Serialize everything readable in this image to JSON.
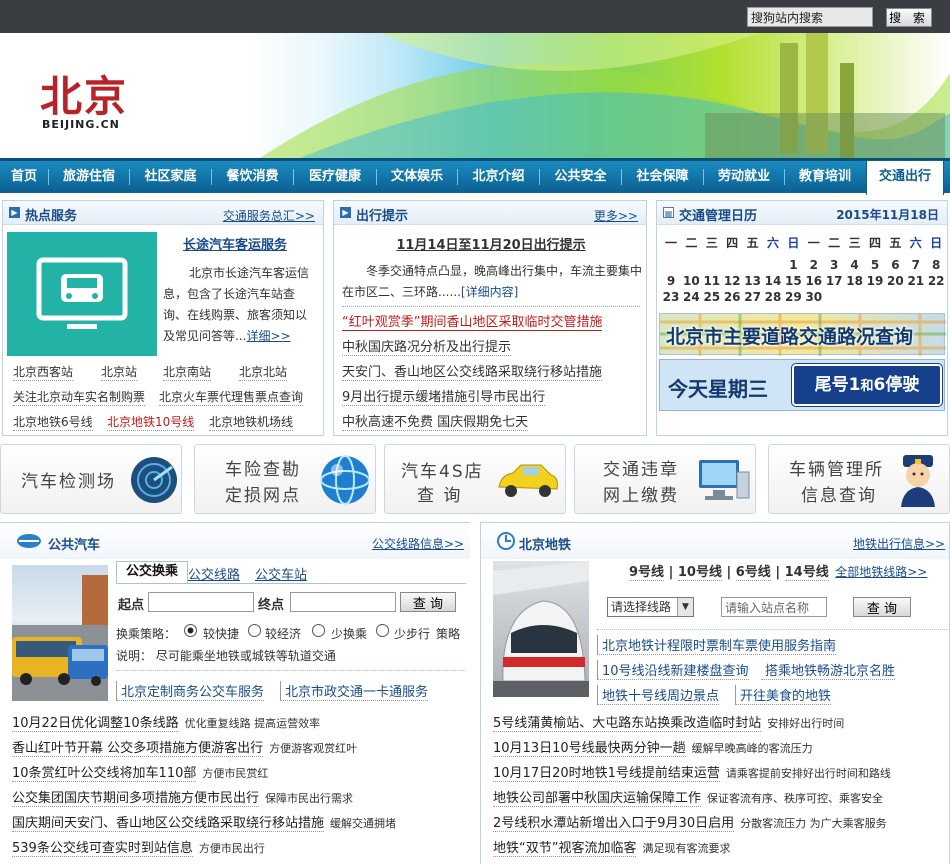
{
  "search": {
    "placeholder": "搜狗站内搜索",
    "button": "搜 索"
  },
  "logo": {
    "cn": "北京",
    "en": "BEIJING.CN"
  },
  "nav": [
    "首页",
    "旅游住宿",
    "社区家庭",
    "餐饮消费",
    "医疗健康",
    "文体娱乐",
    "北京介绍",
    "公共安全",
    "社会保障",
    "劳动就业",
    "教育培训",
    "交通出行"
  ],
  "hot": {
    "title": "热点服务",
    "more": "交通服务总汇>>",
    "feature_title": "长途汽车客运服务",
    "feature_desc": "北京市长途汽车客运信息，包含了长途汽车站查询、在线购票、旅客须知以及常见问答等...",
    "detail": "详细>>",
    "links": [
      "北京西客站",
      "北京站",
      "北京南站",
      "北京北站",
      "关注北京动车实名制购票",
      "北京火车票代理售票点查询",
      "北京地铁6号线",
      "北京地铁10号线",
      "北京地铁机场线"
    ]
  },
  "trip": {
    "title": "出行提示",
    "more": "更多>>",
    "headline": "11月14日至11月20日出行提示",
    "summary": "冬季交通特点凸显，晚高峰出行集中，车流主要集中在市区二、三环路......",
    "detail": "[详细内容]",
    "items": [
      "“红叶观赏季”期间香山地区采取临时交管措施",
      "中秋国庆路况分析及出行提示",
      "天安门、香山地区公交线路采取绕行移站措施",
      "9月出行提示缓堵措施引导市民出行",
      "中秋高速不免费 国庆假期免七天"
    ]
  },
  "calendar": {
    "title": "交通管理日历",
    "date": "2015年11月18日",
    "weekdays": [
      "一",
      "二",
      "三",
      "四",
      "五",
      "六",
      "日",
      "一",
      "二",
      "三",
      "四",
      "五",
      "六",
      "日"
    ],
    "rows": [
      [
        "",
        "",
        "",
        "",
        "",
        "",
        "1",
        "2",
        "3",
        "4",
        "5",
        "6",
        "7",
        "8"
      ],
      [
        "9",
        "10",
        "11",
        "12",
        "13",
        "14",
        "15",
        "16",
        "17",
        "18",
        "19",
        "20",
        "21",
        "22"
      ],
      [
        "23",
        "24",
        "25",
        "26",
        "27",
        "28",
        "29",
        "30",
        "",
        "",
        "",
        "",
        "",
        ""
      ]
    ],
    "road_query": "北京市主要道路交通路况查询",
    "today": "今天星期三",
    "plate_a": "尾号1",
    "plate_and": "和",
    "plate_b": "6停驶"
  },
  "services": [
    {
      "l1": "汽车检测场",
      "l2": ""
    },
    {
      "l1": "车险查勘",
      "l2": "定损网点"
    },
    {
      "l1": "汽车4S店",
      "l2": "查 询"
    },
    {
      "l1": "交通违章",
      "l2": "网上缴费"
    },
    {
      "l1": "车辆管理所",
      "l2": "信息查询"
    }
  ],
  "bus": {
    "title": "公共汽车",
    "more": "公交线路信息>>",
    "tabs": [
      "公交换乘",
      "公交线路",
      "公交车站"
    ],
    "start_label": "起点",
    "end_label": "终点",
    "query": "查 询",
    "strategy_label": "换乘策略：",
    "strategies": [
      "较快捷",
      "较经济",
      "少换乘",
      "少步行"
    ],
    "strategy_suffix": "策略",
    "note": "说明： 尽可能乘坐地铁或城铁等轨道交通",
    "links": [
      "北京定制商务公交车服务",
      "北京市政交通一卡通服务"
    ],
    "news": [
      {
        "t": "10月22日优化调整10条线路",
        "s": "优化重复线路 提高运营效率"
      },
      {
        "t": "香山红叶节开幕 公交多项措施方便游客出行",
        "s": "方便游客观赏红叶"
      },
      {
        "t": "10条赏红叶公交线将加车110部",
        "s": "方便市民赏红"
      },
      {
        "t": "公交集团国庆节期间多项措施方便市民出行",
        "s": "保障市民出行需求"
      },
      {
        "t": "国庆期间天安门、香山地区公交线路采取绕行移站措施",
        "s": "缓解交通拥堵"
      },
      {
        "t": "539条公交线可查实时到站信息",
        "s": "方便市民出行"
      }
    ]
  },
  "subway": {
    "title": "北京地铁",
    "more": "地铁出行信息>>",
    "lines": [
      "9号线",
      "10号线",
      "6号线",
      "14号线"
    ],
    "all_lines": "全部地铁线路>>",
    "select": "请选择线路",
    "station_placeholder": "请输入站点名称",
    "query": "查 询",
    "links": [
      "北京地铁计程限时票制车票使用服务指南",
      "10号线沿线新建楼盘查询",
      "搭乘地铁畅游北京名胜",
      "地铁十号线周边景点",
      "开往美食的地铁"
    ],
    "news": [
      {
        "t": "5号线蒲黄榆站、大屯路东站换乘改造临时封站",
        "s": "安排好出行时间"
      },
      {
        "t": "10月13日10号线最快两分钟一趟",
        "s": "缓解早晚高峰的客流压力"
      },
      {
        "t": "10月17日20时地铁1号线提前结束运营",
        "s": "请乘客提前安排好出行时间和路线"
      },
      {
        "t": "地铁公司部署中秋国庆运输保障工作",
        "s": "保证客流有序、秩序可控、乘客安全"
      },
      {
        "t": "2号线积水潭站新增出入口于9月30日启用",
        "s": "分散客流压力 为广大乘客服务"
      },
      {
        "t": "地铁“双节”视客流加临客",
        "s": "满足现有客流要求"
      }
    ]
  }
}
